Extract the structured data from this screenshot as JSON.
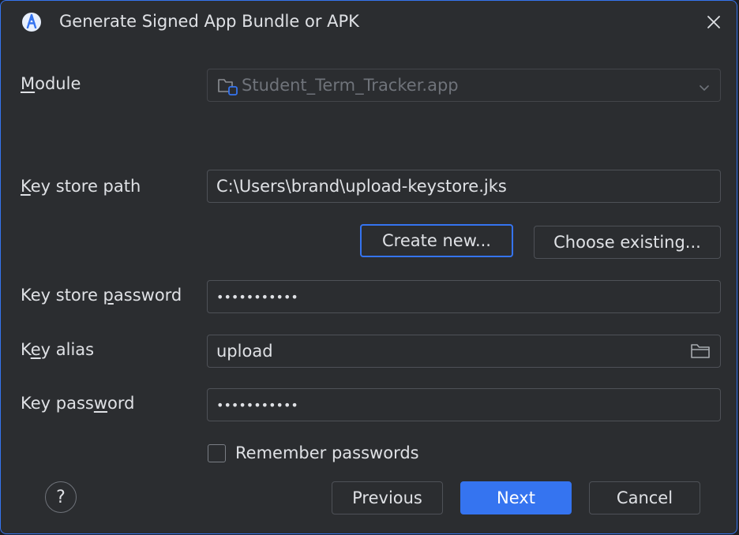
{
  "window": {
    "title": "Generate Signed App Bundle or APK",
    "icon": "android-studio-icon",
    "close_icon": "close-icon"
  },
  "module": {
    "label_pre": "",
    "label_mnemonic": "M",
    "label_post": "odule",
    "value": "Student_Term_Tracker.app",
    "enabled": false
  },
  "keystore_path": {
    "label_pre": "",
    "label_mnemonic": "K",
    "label_post": "ey store path",
    "value": "C:\\Users\\brand\\upload-keystore.jks"
  },
  "keystore_buttons": {
    "create_new": "Create new...",
    "choose_existing": "Choose existing..."
  },
  "keystore_password": {
    "label_pre": "Key store ",
    "label_mnemonic": "p",
    "label_post": "assword",
    "value": "•••••••••••"
  },
  "key_alias": {
    "label_pre": "K",
    "label_mnemonic": "e",
    "label_post": "y alias",
    "value": "upload"
  },
  "key_password": {
    "label_pre": "Key pass",
    "label_mnemonic": "w",
    "label_post": "ord",
    "value": "•••••••••••"
  },
  "remember_passwords": {
    "label": "Remember passwords",
    "checked": false
  },
  "footer": {
    "help": "?",
    "previous": "Previous",
    "next": "Next",
    "cancel": "Cancel"
  },
  "colors": {
    "accent": "#3574f0",
    "background": "#2b2d30",
    "text": "#dfe1e5",
    "disabled_text": "#6f737a",
    "border": "#4e5157"
  }
}
